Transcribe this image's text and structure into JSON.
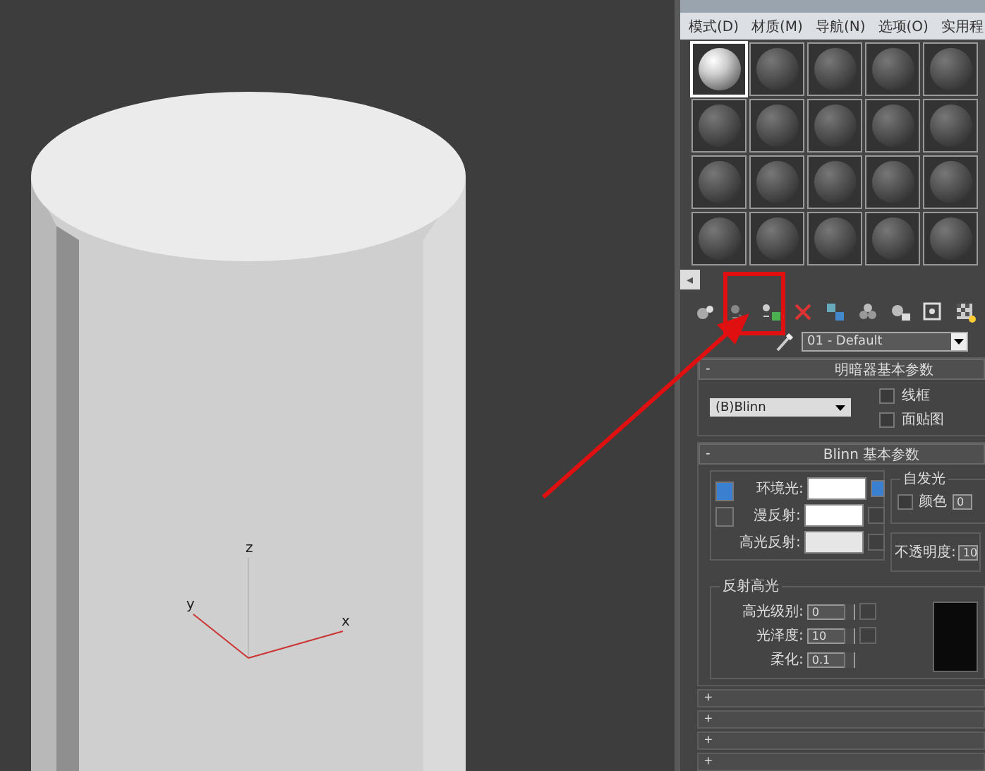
{
  "viewport": {
    "axes": [
      {
        "label": "z",
        "kind": "z"
      },
      {
        "label": "x",
        "kind": "x"
      },
      {
        "label": "y",
        "kind": "y"
      }
    ]
  },
  "material_editor": {
    "menu": [
      "模式(D)",
      "材质(M)",
      "导航(N)",
      "选项(O)",
      "实用程"
    ],
    "slots": [
      {
        "selected": true
      },
      {
        "selected": false
      },
      {
        "selected": false
      },
      {
        "selected": false
      },
      {
        "selected": false
      },
      {
        "selected": false
      },
      {
        "selected": false
      },
      {
        "selected": false
      },
      {
        "selected": false
      },
      {
        "selected": false
      },
      {
        "selected": false
      },
      {
        "selected": false
      },
      {
        "selected": false
      },
      {
        "selected": false
      },
      {
        "selected": false
      },
      {
        "selected": false
      },
      {
        "selected": false
      },
      {
        "selected": false
      },
      {
        "selected": false
      },
      {
        "selected": false
      }
    ],
    "scroll_arrow": "◂",
    "toolbar": [
      {
        "kind": "get"
      },
      {
        "kind": "put"
      },
      {
        "kind": "assign"
      },
      {
        "kind": "delete"
      },
      {
        "kind": "copy"
      },
      {
        "kind": "unique"
      },
      {
        "kind": "library"
      },
      {
        "kind": "id"
      },
      {
        "kind": "map"
      }
    ],
    "material_name": "01 - Default",
    "shader_rollout": {
      "toggle": "-",
      "title": "明暗器基本参数",
      "shader": "(B)Blinn",
      "options": [
        {
          "label": "线框",
          "checked": false
        },
        {
          "label": "面贴图",
          "checked": false
        }
      ]
    },
    "blinn_rollout": {
      "toggle": "-",
      "title": "Blinn 基本参数",
      "colors": [
        {
          "label": "环境光:",
          "color": "#ffffff",
          "locked": true
        },
        {
          "label": "漫反射:",
          "color": "#ffffff"
        },
        {
          "label": "高光反射:",
          "color": "#e6e6e6"
        }
      ],
      "self_illum": {
        "title": "自发光",
        "label": "颜色",
        "checked": false,
        "value": "0"
      },
      "opacity": {
        "label": "不透明度:",
        "value": "10"
      },
      "specular": {
        "title": "反射高光",
        "fields": [
          {
            "label": "高光级别:",
            "value": "0"
          },
          {
            "label": "光泽度:",
            "value": "10"
          },
          {
            "label": "柔化:",
            "value": "0.1"
          }
        ]
      }
    },
    "collapsed_rollouts": [
      "+",
      "+",
      "+",
      "+"
    ]
  }
}
